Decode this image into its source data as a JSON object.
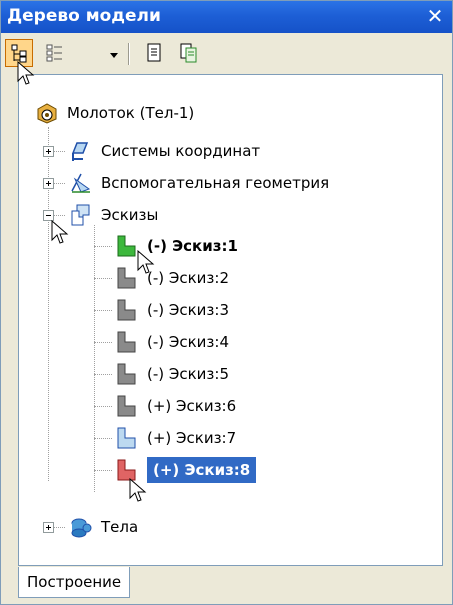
{
  "window": {
    "title": "Дерево модели",
    "close_label": "✕"
  },
  "toolbar": {
    "buttons": [
      {
        "icon": "tree-structure-icon",
        "active": true
      },
      {
        "icon": "list-mode-icon",
        "active": false
      },
      {
        "icon": "document-icon",
        "active": false
      },
      {
        "icon": "document-copy-icon",
        "active": false
      }
    ]
  },
  "tree": {
    "root": "Молоток (Тел-1)",
    "items": [
      {
        "label": "Системы координат",
        "icon": "coordinate-system-icon",
        "expanded": false
      },
      {
        "label": "Вспомогательная геометрия",
        "icon": "auxiliary-geometry-icon",
        "expanded": false
      },
      {
        "label": "Эскизы",
        "icon": "sketches-icon",
        "expanded": true
      },
      {
        "label": "Тела",
        "icon": "bodies-icon",
        "expanded": false
      }
    ],
    "sketches": [
      {
        "label": "(-) Эскиз:1",
        "state": "active",
        "color": "#3db83d"
      },
      {
        "label": "(-) Эскиз:2",
        "state": "normal",
        "color": "#8a8a8a"
      },
      {
        "label": "(-) Эскиз:3",
        "state": "normal",
        "color": "#8a8a8a"
      },
      {
        "label": "(-) Эскиз:4",
        "state": "normal",
        "color": "#8a8a8a"
      },
      {
        "label": "(-) Эскиз:5",
        "state": "normal",
        "color": "#8a8a8a"
      },
      {
        "label": "(+) Эскиз:6",
        "state": "normal",
        "color": "#8a8a8a"
      },
      {
        "label": "(+) Эскиз:7",
        "state": "normal",
        "color": "#7fb3e0"
      },
      {
        "label": "(+) Эскиз:8",
        "state": "selected",
        "color": "#e06464"
      }
    ]
  },
  "tabs": {
    "active": "Построение"
  },
  "colors": {
    "title_bar": "#1d5fd6",
    "selection": "#316ac5",
    "panel": "#ece9d8"
  }
}
